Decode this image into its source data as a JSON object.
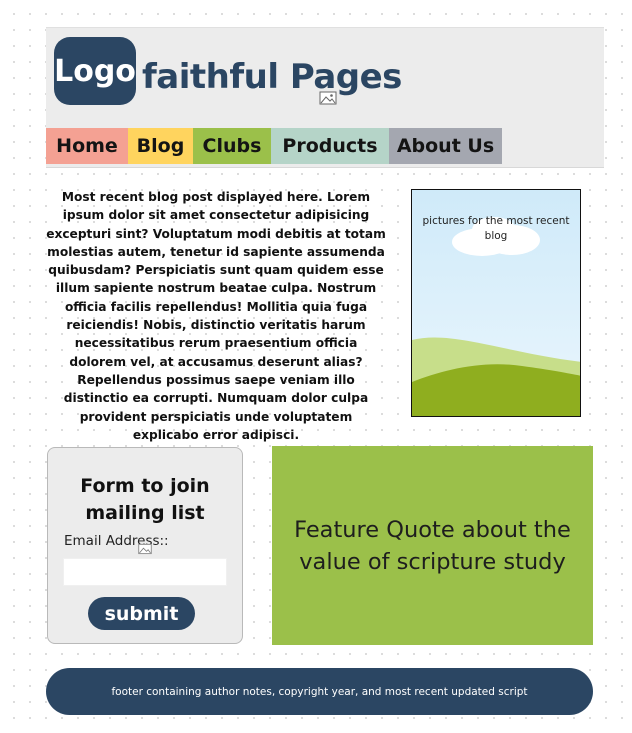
{
  "header": {
    "logo_text": "Logo",
    "site_title": "faithful Pages",
    "background_color": "#ececec",
    "brand_color": "#2b4663"
  },
  "nav": {
    "items": [
      {
        "label": "Home",
        "color": "#f4a193"
      },
      {
        "label": "Blog",
        "color": "#ffd45e"
      },
      {
        "label": "Clubs",
        "color": "#9bc04a"
      },
      {
        "label": "Products",
        "color": "#b5d4c8"
      },
      {
        "label": "About Us",
        "color": "#a4a7b0"
      }
    ]
  },
  "blog": {
    "text": "Most recent blog post displayed here.  Lorem ipsum dolor sit amet consectetur adipisicing  excepturi sint? Voluptatum modi debitis at totam molestias autem, tenetur id sapiente assumenda quibusdam? Perspiciatis sunt quam quidem esse illum sapiente nostrum beatae culpa. Nostrum officia facilis repellendus! Mollitia quia fuga reiciendis! Nobis, distinctio veritatis harum necessitatibus rerum praesentium officia dolorem vel, at accusamus deserunt alias? Repellendus possimus saepe veniam illo distinctio ea corrupti. Numquam dolor culpa provident perspiciatis unde voluptatem explicabo error adipisci.",
    "picture_caption": "pictures for the most recent blog"
  },
  "form": {
    "title": "Form to join mailing list",
    "email_label": "Email Address::",
    "email_value": "",
    "submit_label": "submit"
  },
  "quote": {
    "text": "Feature Quote about the value of scripture study",
    "background_color": "#9bc04a"
  },
  "footer": {
    "text": "footer containing author notes, copyright year, and most recent updated script"
  },
  "icons": {
    "image_placeholder": "image-placeholder-icon"
  }
}
